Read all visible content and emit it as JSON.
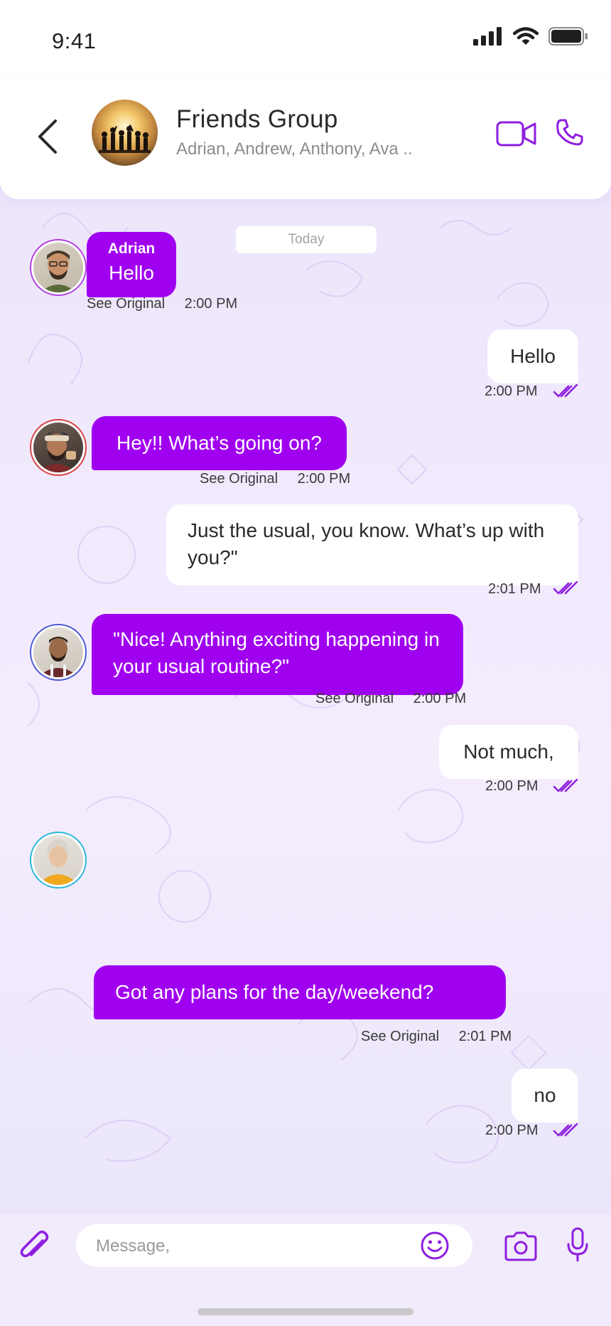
{
  "status_bar": {
    "time": "9:41"
  },
  "header": {
    "title": "Friends Group",
    "subtitle": "Adrian, Andrew, Anthony, Ava .."
  },
  "chat": {
    "date_label": "Today",
    "see_original_label": "See Original",
    "messages": [
      {
        "direction": "incoming",
        "sender": "Adrian",
        "text": "Hello",
        "time": "2:00 PM"
      },
      {
        "direction": "outgoing",
        "text": "Hello",
        "time": "2:00 PM",
        "status": "read"
      },
      {
        "direction": "incoming",
        "text": "Hey!! What’s going on?",
        "time": "2:00 PM"
      },
      {
        "direction": "outgoing",
        "text": "Just the usual, you know. What’s up with you?\"",
        "time": "2:01 PM",
        "status": "read"
      },
      {
        "direction": "incoming",
        "text": "\"Nice! Anything exciting happening in your usual routine?\"",
        "time": "2:00 PM"
      },
      {
        "direction": "outgoing",
        "text": "Not much,",
        "time": "2:00 PM",
        "status": "read"
      },
      {
        "direction": "incoming",
        "text": "Got any plans for the day/weekend?",
        "time": "2:01 PM"
      },
      {
        "direction": "outgoing",
        "text": "no",
        "time": "2:00 PM",
        "status": "read"
      }
    ]
  },
  "composer": {
    "placeholder": "Message,"
  },
  "colors": {
    "accent": "#a000f0",
    "icon": "#8e1ee0",
    "background": "#f1ebfb",
    "avatar_rings": [
      "#b040e0",
      "#d84040",
      "#4a5ad0",
      "#28b8d8"
    ]
  }
}
